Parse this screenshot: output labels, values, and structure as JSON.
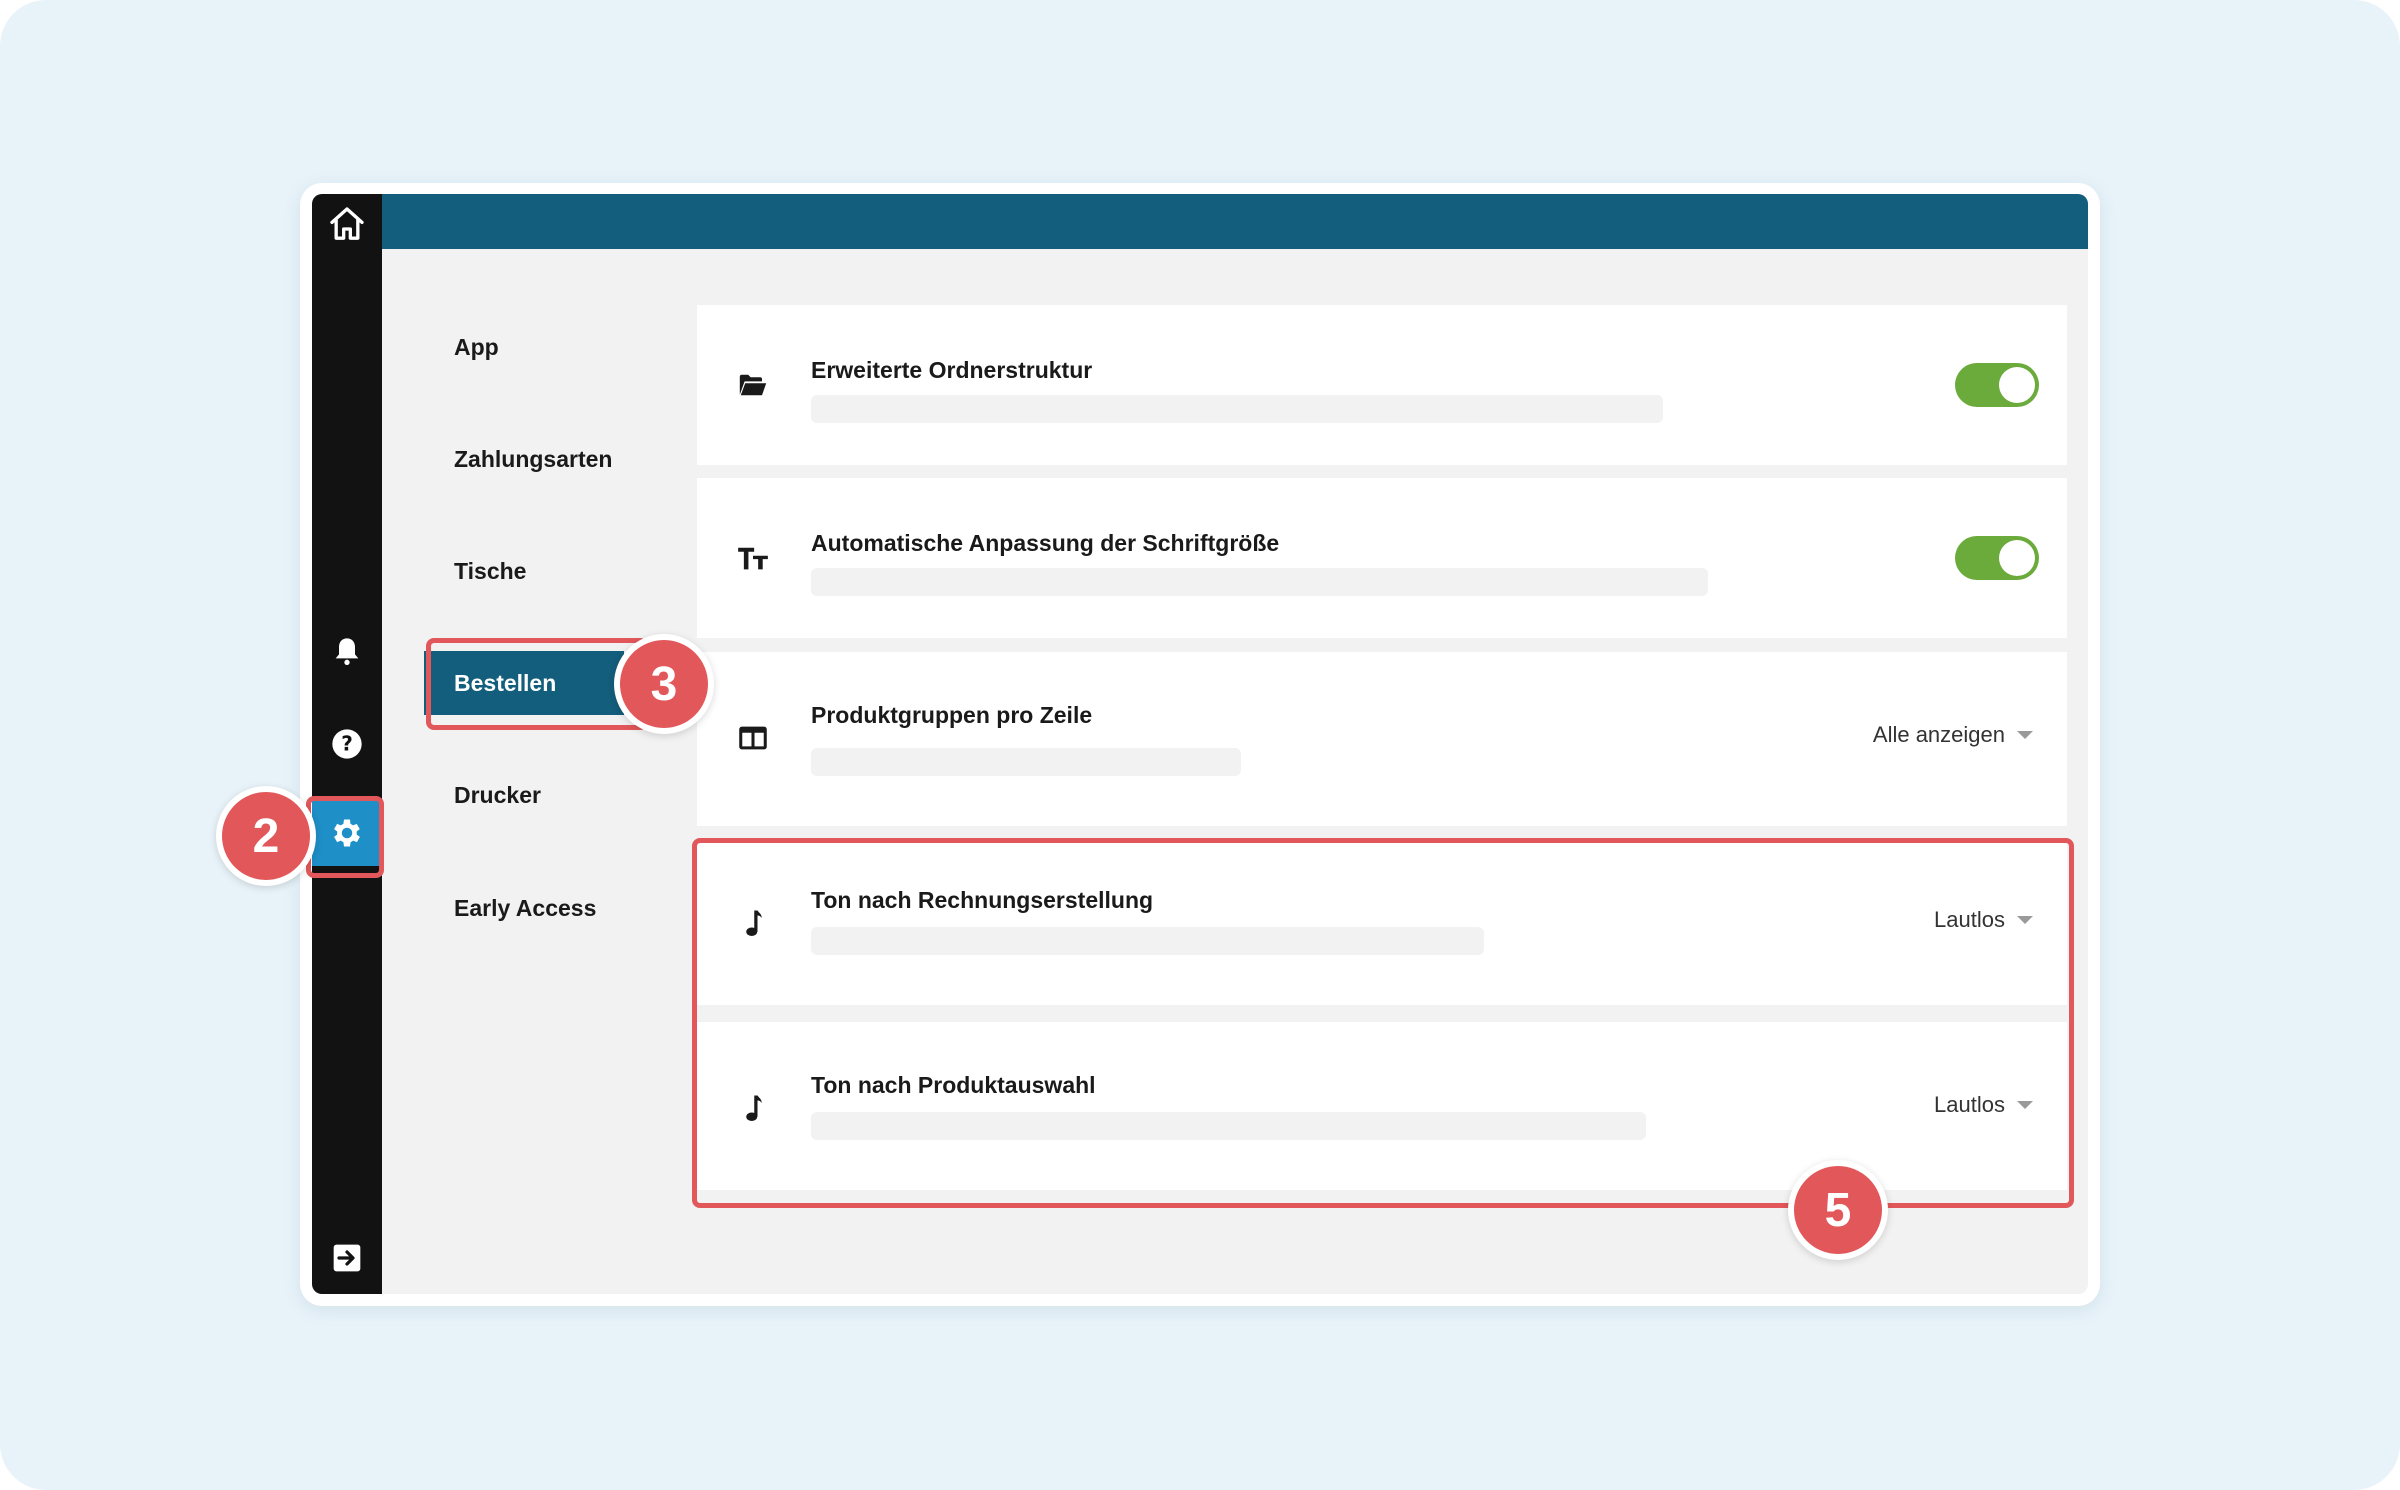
{
  "sidebar": {
    "icons": [
      "home-icon",
      "bell-icon",
      "help-icon",
      "gear-icon",
      "logout-icon"
    ]
  },
  "nav": {
    "items": [
      {
        "label": "App"
      },
      {
        "label": "Zahlungsarten"
      },
      {
        "label": "Tische"
      },
      {
        "label": "Bestellen"
      },
      {
        "label": "Drucker"
      },
      {
        "label": "Early Access"
      }
    ],
    "active": "Bestellen"
  },
  "settings": [
    {
      "title": "Erweiterte Ordnerstruktur",
      "icon": "folder-open-icon",
      "control": "toggle",
      "on": true
    },
    {
      "title": "Automatische Anpassung der Schriftgröße",
      "icon": "text-size-icon",
      "control": "toggle",
      "on": true
    },
    {
      "title": "Produktgruppen pro Zeile",
      "icon": "columns-icon",
      "control": "dropdown",
      "value": "Alle anzeigen"
    },
    {
      "title": "Ton nach Rechnungserstellung",
      "icon": "music-note-icon",
      "control": "dropdown",
      "value": "Lautlos"
    },
    {
      "title": "Ton nach Produktauswahl",
      "icon": "music-note-icon",
      "control": "dropdown",
      "value": "Lautlos"
    }
  ],
  "annotations": {
    "badge_settings": "2",
    "badge_bestellen": "3",
    "badge_sounds": "5"
  },
  "colors": {
    "accent": "#135e7c",
    "active_icon_bg": "#1e8fc7",
    "toggle_on": "#6aab3b",
    "highlight": "#e2575a",
    "background": "#e8f3f9"
  }
}
